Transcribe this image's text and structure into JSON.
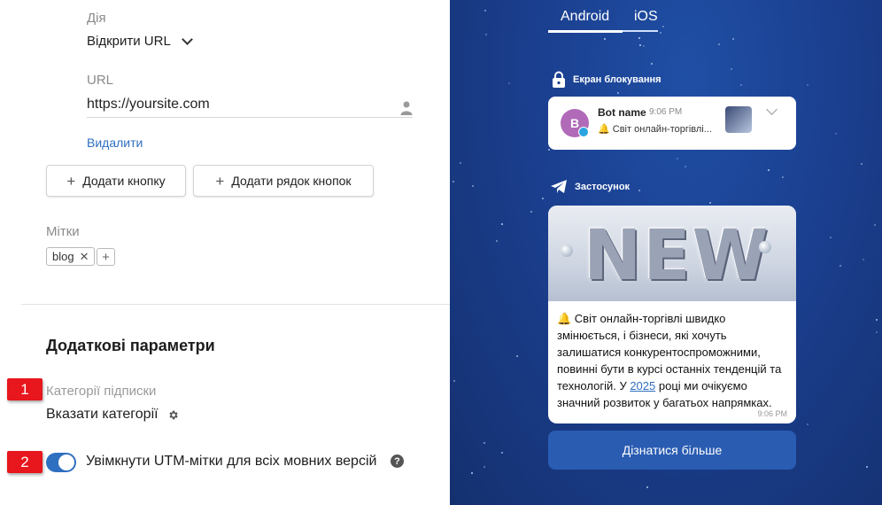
{
  "action": {
    "label": "Дія",
    "value": "Відкрити URL"
  },
  "url": {
    "label": "URL",
    "value": "https://yoursite.com"
  },
  "delete_label": "Видалити",
  "buttons": {
    "add_button": "Додати кнопку",
    "add_row": "Додати рядок кнопок"
  },
  "tags": {
    "label": "Мітки",
    "items": [
      "blog"
    ]
  },
  "extra": {
    "title": "Додаткові параметри",
    "categories_label": "Категорії підписки",
    "categories_value": "Вказати категорії",
    "utm_label": "Увімкнути UTM-мітки для всіх мовних версій",
    "utm_enabled": true
  },
  "badges": [
    "1",
    "2"
  ],
  "preview": {
    "tabs": [
      "Android",
      "iOS"
    ],
    "active_tab": "Android",
    "lock_section": "Екран блокування",
    "app_section": "Застосунок",
    "notification": {
      "avatar_letter": "B",
      "bot_name": "Bot name",
      "time": "9:06 PM",
      "text": "🔔 Світ онлайн-торгівлі..."
    },
    "message": {
      "image_text": "NEW",
      "text_before": "🔔 Світ онлайн-торгівлі швидко змінюється, і бізнеси, які хочуть залишатися конкурентоспроможними, повинні бути в курсі останніх тенденцій та технологій. У ",
      "link": "2025",
      "text_after": " році ми очікуємо значний розвиток у багатьох напрямках.",
      "time": "9:06 PM"
    },
    "button": "Дізнатися більше"
  },
  "colors": {
    "accent": "#2f6fc0",
    "badge": "#e8161d",
    "preview_bg": "#1b3f8f"
  }
}
